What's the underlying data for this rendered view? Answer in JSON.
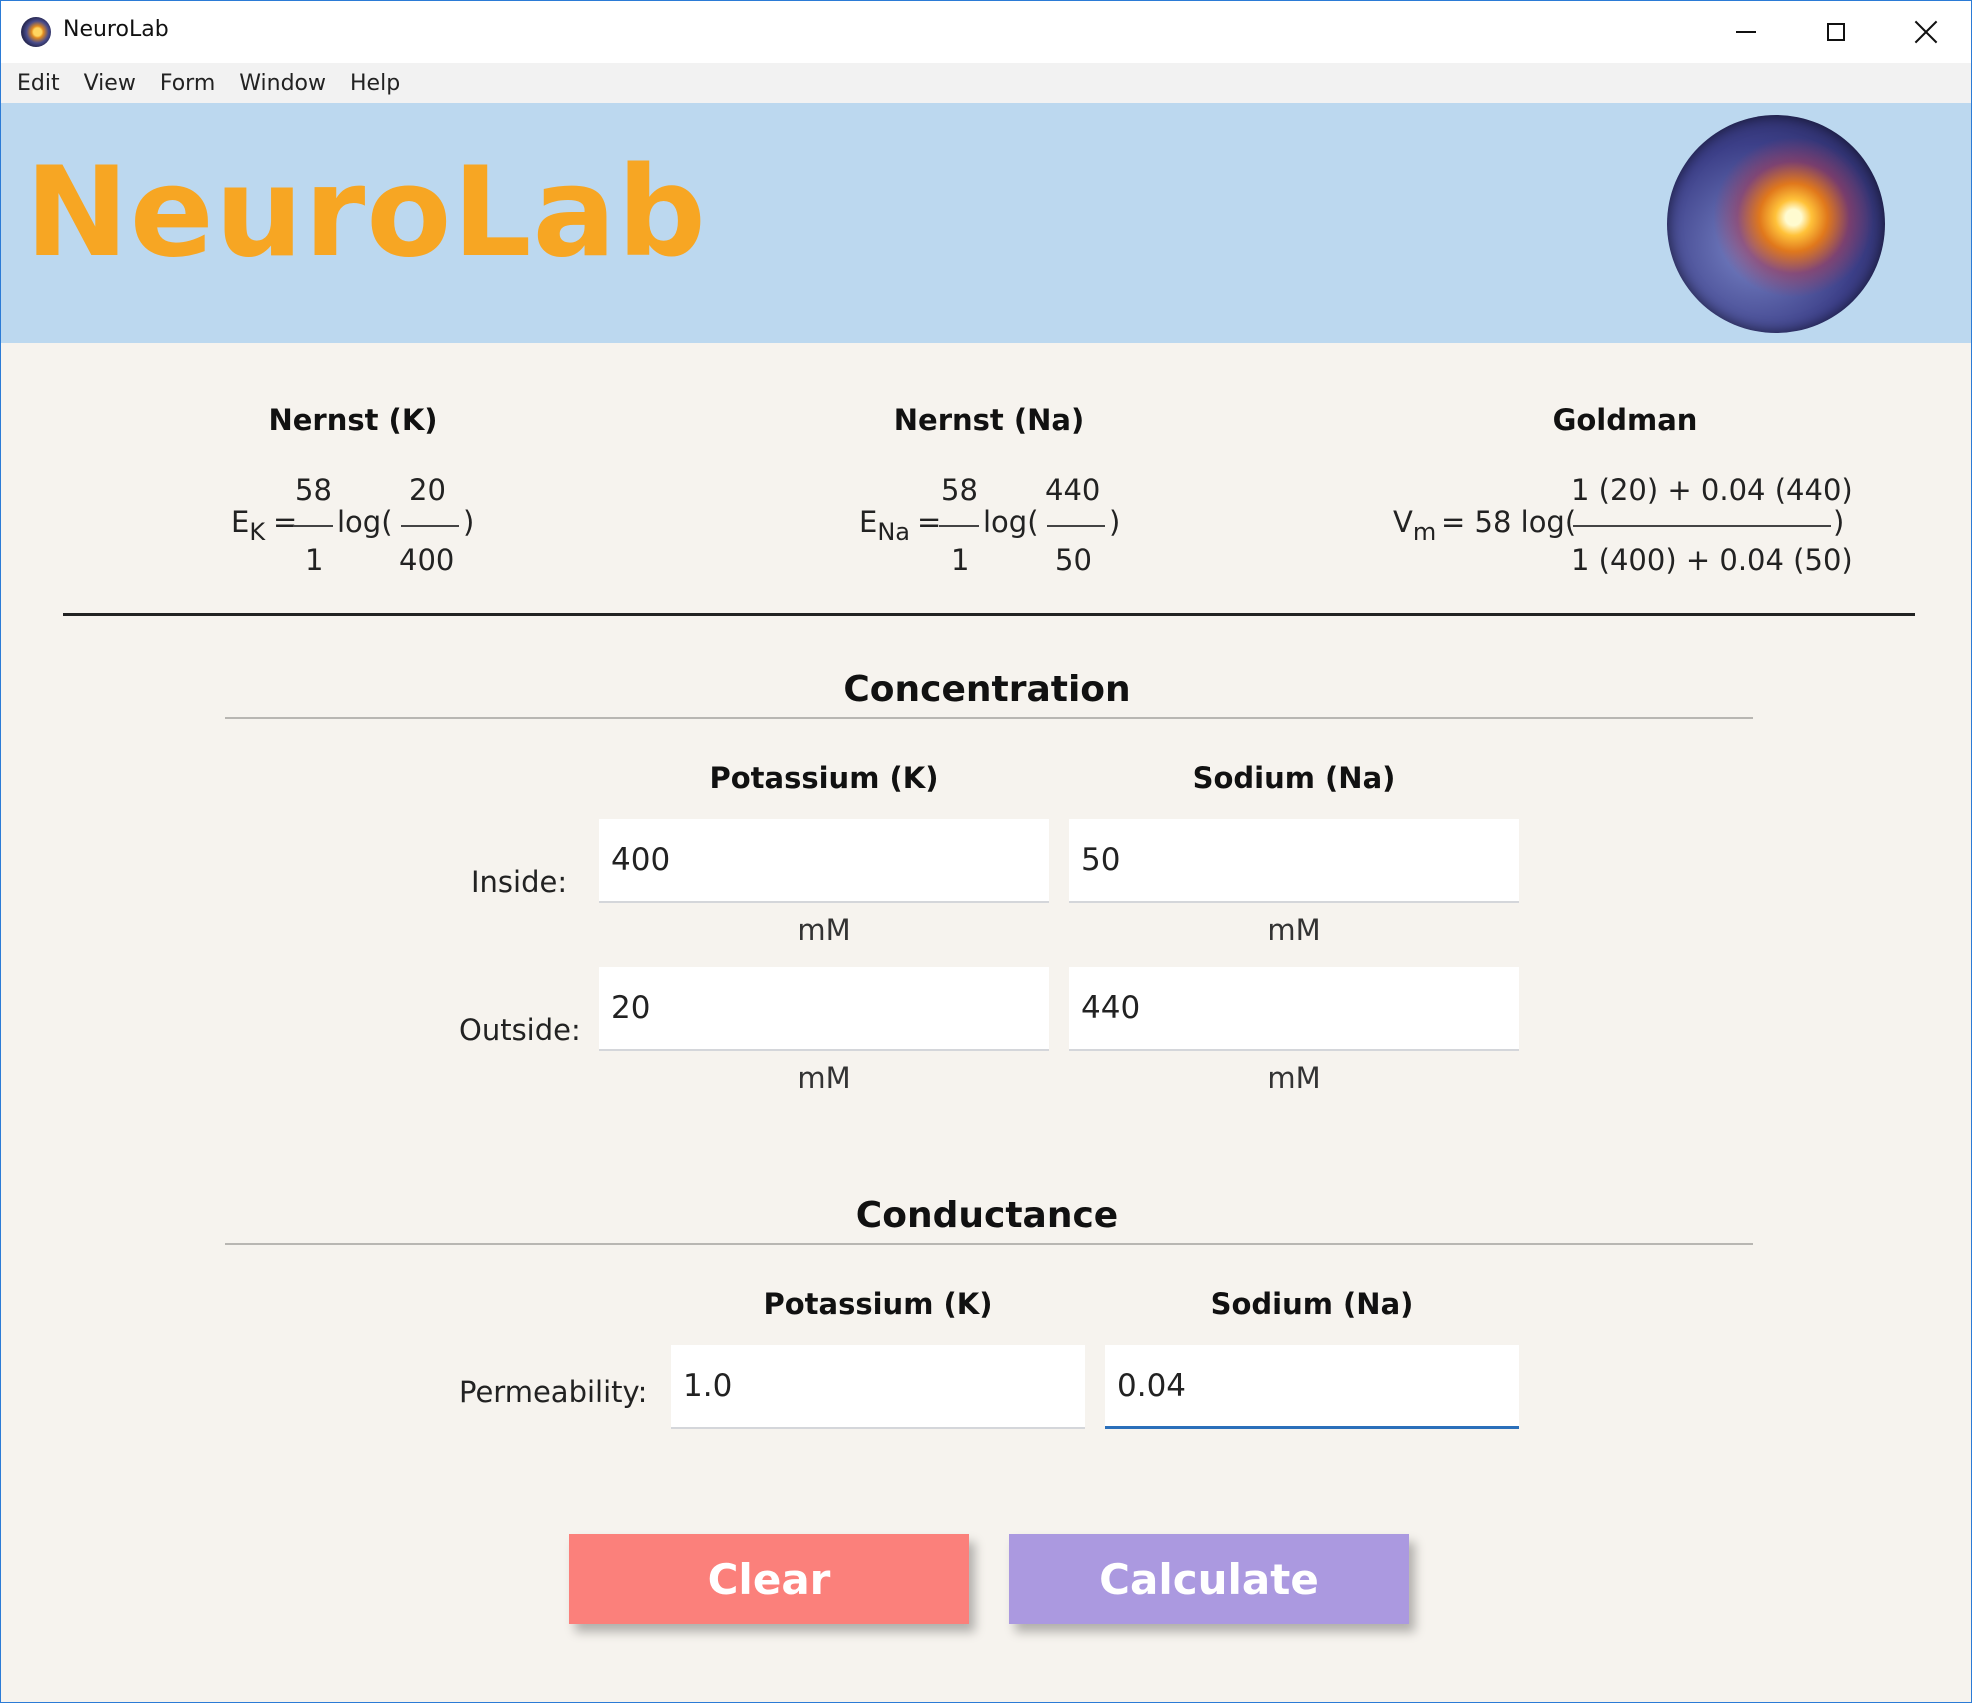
{
  "window": {
    "title": "NeuroLab"
  },
  "menu": [
    "Edit",
    "View",
    "Form",
    "Window",
    "Help"
  ],
  "header": {
    "brand": "NeuroLab",
    "logo": "neuron-logo"
  },
  "formulas": {
    "nernst_k": {
      "title": "Nernst (K)",
      "lhs": "E",
      "lhs_sub": "K",
      "eq": "=",
      "num1": "58",
      "den1": "1",
      "log": "log(",
      "num2": "20",
      "den2": "400",
      "close": ")"
    },
    "nernst_na": {
      "title": "Nernst (Na)",
      "lhs": "E",
      "lhs_sub": "Na",
      "eq": "=",
      "num1": "58",
      "den1": "1",
      "log": "log(",
      "num2": "440",
      "den2": "50",
      "close": ")"
    },
    "goldman": {
      "title": "Goldman",
      "lhs": "V",
      "lhs_sub": "m",
      "eq": "= 58 log(",
      "num": "1 (20) + 0.04 (440)",
      "den": "1 (400) + 0.04 (50)",
      "close": ")"
    }
  },
  "concentration": {
    "title": "Concentration",
    "col_k": "Potassium (K)",
    "col_na": "Sodium (Na)",
    "inside_label": "Inside:",
    "outside_label": "Outside:",
    "inside_k": "400",
    "inside_na": "50",
    "outside_k": "20",
    "outside_na": "440",
    "unit": "mM"
  },
  "conductance": {
    "title": "Conductance",
    "col_k": "Potassium (K)",
    "col_na": "Sodium (Na)",
    "perm_label": "Permeability:",
    "perm_k": "1.0",
    "perm_na": "0.04"
  },
  "buttons": {
    "clear": "Clear",
    "calculate": "Calculate"
  },
  "colors": {
    "brand": "#f7a623",
    "header_bg": "#bcd8ef",
    "clear": "#fb807b",
    "calculate": "#ab99e0",
    "focus": "#2a6fba"
  }
}
